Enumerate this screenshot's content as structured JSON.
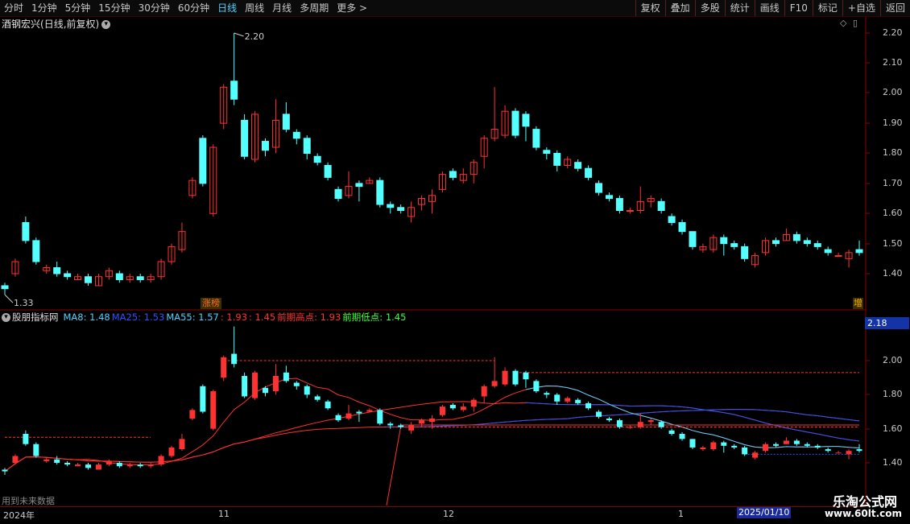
{
  "toolbar": {
    "periods": [
      "分时",
      "1分钟",
      "5分钟",
      "15分钟",
      "30分钟",
      "60分钟",
      "日线",
      "周线",
      "月线",
      "多周期",
      "更多 >"
    ],
    "active_period": "日线",
    "actions": [
      "复权",
      "叠加",
      "多股",
      "统计",
      "画线",
      "F10",
      "标记",
      "+自选",
      "返回"
    ]
  },
  "main_panel": {
    "stock_name": "酒钢宏兴",
    "mode": "(日线,前复权)",
    "high_label": "2.20",
    "low_label": "1.33",
    "tag_left": "涨榜",
    "tag_right": "增"
  },
  "sub_panel": {
    "indicator_name": "股朋指标网",
    "items": [
      {
        "label": "MA8: 1.48",
        "color": "#4fd2ff"
      },
      {
        "label": "MA25: 1.53",
        "color": "#2a54ff"
      },
      {
        "label": "MA55: 1.57",
        "color": "#4fd2ff"
      },
      {
        "label": ": 1.93",
        "color": "#ff3030"
      },
      {
        "label": ": 1.45",
        "color": "#ff3030"
      },
      {
        "label": "前期高点: 1.93",
        "color": "#ff3030"
      },
      {
        "label": "前期低点: 1.45",
        "color": "#3cff3c"
      }
    ],
    "current_value": "2.18",
    "future_note": "用到未来数据"
  },
  "axes": {
    "main_y": [
      "2.20",
      "2.10",
      "2.00",
      "1.90",
      "1.80",
      "1.70",
      "1.60",
      "1.50",
      "1.40"
    ],
    "sub_y": [
      "2.00",
      "1.80",
      "1.60",
      "1.40"
    ],
    "dates": [
      "2024年",
      "11",
      "12",
      "1"
    ],
    "current_date": "2025/01/10"
  },
  "watermark": {
    "main": "乐淘公式网",
    "url": "www.60lt.com"
  },
  "colors": {
    "up": "#ff3232",
    "down": "#54ffff",
    "axis": "#8a0000"
  },
  "chart_data": {
    "type": "candlestick",
    "candles": [
      [
        1.36,
        1.35,
        1.37,
        1.33
      ],
      [
        1.4,
        1.44,
        1.45,
        1.39
      ],
      [
        1.57,
        1.51,
        1.59,
        1.5
      ],
      [
        1.51,
        1.44,
        1.52,
        1.43
      ],
      [
        1.41,
        1.42,
        1.43,
        1.4
      ],
      [
        1.42,
        1.4,
        1.44,
        1.39
      ],
      [
        1.4,
        1.39,
        1.41,
        1.38
      ],
      [
        1.38,
        1.39,
        1.4,
        1.38
      ],
      [
        1.39,
        1.37,
        1.4,
        1.36
      ],
      [
        1.36,
        1.39,
        1.4,
        1.36
      ],
      [
        1.39,
        1.41,
        1.42,
        1.38
      ],
      [
        1.4,
        1.38,
        1.41,
        1.37
      ],
      [
        1.38,
        1.39,
        1.4,
        1.37
      ],
      [
        1.39,
        1.38,
        1.4,
        1.37
      ],
      [
        1.38,
        1.39,
        1.4,
        1.37
      ],
      [
        1.39,
        1.44,
        1.45,
        1.38
      ],
      [
        1.44,
        1.49,
        1.5,
        1.43
      ],
      [
        1.48,
        1.54,
        1.57,
        1.47
      ],
      [
        1.66,
        1.71,
        1.72,
        1.65
      ],
      [
        1.85,
        1.7,
        1.86,
        1.69
      ],
      [
        1.6,
        1.82,
        1.83,
        1.59
      ],
      [
        1.9,
        2.02,
        2.03,
        1.88
      ],
      [
        2.04,
        1.98,
        2.2,
        1.96
      ],
      [
        1.91,
        1.79,
        1.93,
        1.78
      ],
      [
        1.78,
        1.93,
        1.94,
        1.77
      ],
      [
        1.84,
        1.81,
        1.85,
        1.79
      ],
      [
        1.82,
        1.91,
        1.98,
        1.8
      ],
      [
        1.93,
        1.88,
        1.97,
        1.87
      ],
      [
        1.87,
        1.85,
        1.88,
        1.83
      ],
      [
        1.85,
        1.8,
        1.86,
        1.78
      ],
      [
        1.79,
        1.77,
        1.8,
        1.76
      ],
      [
        1.76,
        1.72,
        1.77,
        1.71
      ],
      [
        1.68,
        1.65,
        1.69,
        1.64
      ],
      [
        1.66,
        1.69,
        1.74,
        1.65
      ],
      [
        1.7,
        1.69,
        1.71,
        1.64
      ],
      [
        1.7,
        1.71,
        1.72,
        1.7
      ],
      [
        1.71,
        1.63,
        1.72,
        1.62
      ],
      [
        1.63,
        1.62,
        1.64,
        1.6
      ],
      [
        1.62,
        1.61,
        1.63,
        1.6
      ],
      [
        1.59,
        1.62,
        1.64,
        1.57
      ],
      [
        1.63,
        1.65,
        1.66,
        1.61
      ],
      [
        1.64,
        1.66,
        1.68,
        1.6
      ],
      [
        1.68,
        1.73,
        1.74,
        1.67
      ],
      [
        1.74,
        1.72,
        1.75,
        1.71
      ],
      [
        1.71,
        1.73,
        1.75,
        1.7
      ],
      [
        1.73,
        1.77,
        1.78,
        1.7
      ],
      [
        1.79,
        1.85,
        1.86,
        1.75
      ],
      [
        1.85,
        1.88,
        2.02,
        1.84
      ],
      [
        1.86,
        1.94,
        1.96,
        1.85
      ],
      [
        1.94,
        1.86,
        1.95,
        1.85
      ],
      [
        1.93,
        1.89,
        1.94,
        1.84
      ],
      [
        1.88,
        1.82,
        1.89,
        1.81
      ],
      [
        1.81,
        1.8,
        1.82,
        1.78
      ],
      [
        1.8,
        1.76,
        1.81,
        1.74
      ],
      [
        1.76,
        1.78,
        1.79,
        1.75
      ],
      [
        1.77,
        1.75,
        1.78,
        1.74
      ],
      [
        1.75,
        1.72,
        1.76,
        1.71
      ],
      [
        1.7,
        1.67,
        1.71,
        1.66
      ],
      [
        1.66,
        1.65,
        1.67,
        1.64
      ],
      [
        1.65,
        1.61,
        1.66,
        1.6
      ],
      [
        1.61,
        1.61,
        1.62,
        1.6
      ],
      [
        1.61,
        1.64,
        1.69,
        1.6
      ],
      [
        1.64,
        1.65,
        1.66,
        1.62
      ],
      [
        1.64,
        1.61,
        1.65,
        1.6
      ],
      [
        1.59,
        1.57,
        1.6,
        1.56
      ],
      [
        1.57,
        1.54,
        1.58,
        1.53
      ],
      [
        1.54,
        1.49,
        1.54,
        1.48
      ],
      [
        1.48,
        1.49,
        1.5,
        1.47
      ],
      [
        1.48,
        1.52,
        1.53,
        1.47
      ],
      [
        1.52,
        1.5,
        1.53,
        1.46
      ],
      [
        1.5,
        1.49,
        1.51,
        1.48
      ],
      [
        1.49,
        1.45,
        1.5,
        1.44
      ],
      [
        1.43,
        1.46,
        1.47,
        1.42
      ],
      [
        1.47,
        1.51,
        1.52,
        1.46
      ],
      [
        1.51,
        1.5,
        1.52,
        1.49
      ],
      [
        1.51,
        1.53,
        1.55,
        1.51
      ],
      [
        1.53,
        1.51,
        1.54,
        1.5
      ],
      [
        1.51,
        1.5,
        1.52,
        1.49
      ],
      [
        1.5,
        1.49,
        1.51,
        1.48
      ],
      [
        1.48,
        1.47,
        1.49,
        1.46
      ],
      [
        1.46,
        1.46,
        1.47,
        1.46
      ],
      [
        1.45,
        1.47,
        1.48,
        1.42
      ],
      [
        1.48,
        1.47,
        1.51,
        1.46
      ]
    ],
    "candle_format": [
      "open",
      "close",
      "high",
      "low"
    ],
    "high_mark": 2.2,
    "low_mark": 1.33,
    "main_ylim": [
      1.31,
      2.24
    ],
    "sub_ylim": [
      1.3,
      2.14
    ]
  }
}
